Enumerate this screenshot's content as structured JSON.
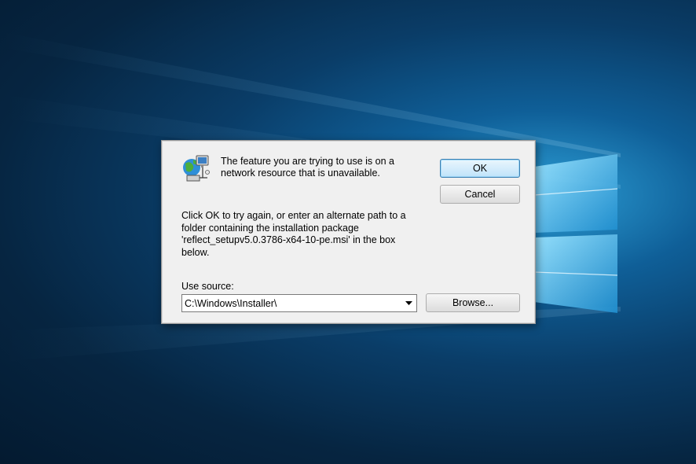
{
  "dialog": {
    "message": "The feature you are trying to use is on a network resource that is unavailable.",
    "instruction": "Click OK to try again, or enter an alternate path to a folder containing the installation package 'reflect_setupv5.0.3786-x64-10-pe.msi' in the box below.",
    "ok_label": "OK",
    "cancel_label": "Cancel",
    "source_label": "Use source:",
    "source_value": "C:\\Windows\\Installer\\",
    "browse_label": "Browse...",
    "icon": "network-computer-icon"
  },
  "colors": {
    "dialog_bg": "#f0f0f0",
    "default_button_border": "#3c7fb1",
    "wallpaper_glow": "#2d9fd6"
  }
}
